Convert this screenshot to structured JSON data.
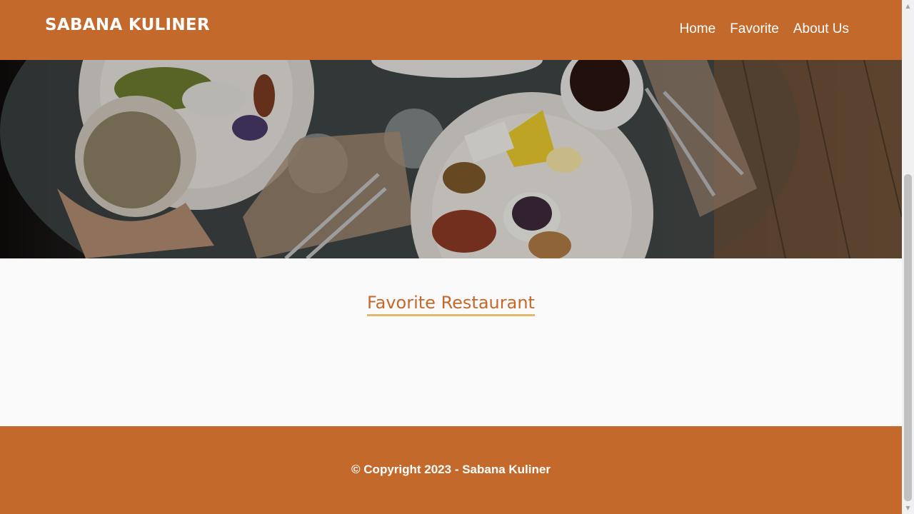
{
  "header": {
    "brand": "SABANA KULINER",
    "nav": [
      {
        "label": "Home"
      },
      {
        "label": "Favorite"
      },
      {
        "label": "About Us"
      }
    ]
  },
  "hero": {
    "image": "table-with-breakfast-plates-and-coffee"
  },
  "main": {
    "title": "Favorite Restaurant"
  },
  "footer": {
    "copyright": "© Copyright 2023 - Sabana Kuliner"
  },
  "colors": {
    "primary": "#c4692c",
    "accent_underline": "#e2b86d",
    "background": "#fafafa"
  }
}
